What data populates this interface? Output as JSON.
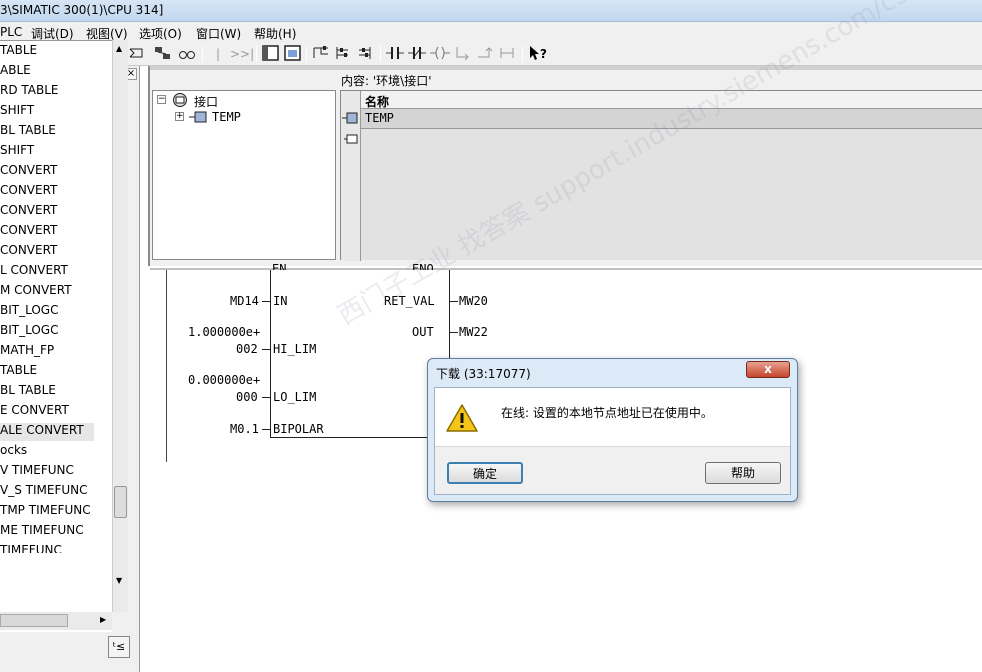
{
  "window": {
    "title": "3\\SIMATIC 300(1)\\CPU 314]"
  },
  "menubar": {
    "items": [
      "PLC",
      "调试(D)",
      "视图(V)",
      "选项(O)",
      "窗口(W)",
      "帮助(H)"
    ]
  },
  "toolbar": {
    "items": [
      "|<<",
      ">>|"
    ]
  },
  "left_list": {
    "items": [
      "TABLE",
      "ABLE",
      "RD   TABLE",
      "SHIFT",
      "BL   TABLE",
      " SHIFT",
      "CONVERT",
      "CONVERT",
      "CONVERT",
      "  CONVERT",
      "  CONVERT",
      "L   CONVERT",
      "M   CONVERT",
      "    BIT_LOGC",
      "  BIT_LOGC",
      "  MATH_FP",
      " TABLE",
      "BL   TABLE",
      "E   CONVERT",
      "ALE   CONVERT",
      "ocks",
      "V    TIMEFUNC",
      "V_S    TIMEFUNC",
      "TMP    TIMEFUNC",
      "ME    TIMEFUNC",
      "   TIMEFUNC"
    ]
  },
  "content_path": "内容:  '环境\\接口'",
  "tree": {
    "root": "接口",
    "child": "TEMP"
  },
  "iface_table": {
    "header": "名称",
    "rows": [
      "TEMP"
    ]
  },
  "ladder": {
    "pins_top": [
      "EN",
      "ENO"
    ],
    "inputs": [
      {
        "operand": "MD14",
        "pin": "IN"
      },
      {
        "operand_line1": "1.000000e+",
        "operand_line2": "002",
        "pin": "HI_LIM"
      },
      {
        "operand_line1": "0.000000e+",
        "operand_line2": "000",
        "pin": "LO_LIM"
      },
      {
        "operand": "M0.1",
        "pin": "BIPOLAR"
      }
    ],
    "outputs": [
      {
        "pin": "RET_VAL",
        "operand": "MW20"
      },
      {
        "pin": "OUT",
        "operand": "MW22"
      }
    ]
  },
  "dialog": {
    "title": "下载 (33:17077)",
    "close_label": "x",
    "message": "在线: 设置的本地节点地址已在使用中。",
    "ok_label": "确定",
    "help_label": "帮助"
  },
  "watermark": "西门子工业  找答案  support.industry.siemens.com/cs"
}
